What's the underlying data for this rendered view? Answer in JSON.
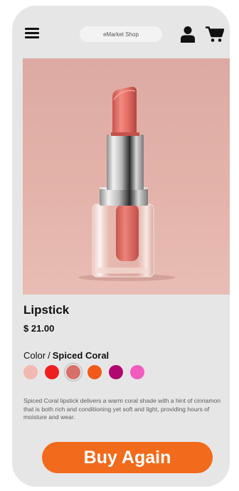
{
  "header": {
    "menu_icon": "hamburger-menu-icon",
    "search_label": "eMarket Shop",
    "user_icon": "user-icon",
    "cart_icon": "shopping-cart-icon"
  },
  "product": {
    "image_icon": "lipstick-product-photo",
    "title": "Lipstick",
    "price": "$ 21.00",
    "color_label": "Color",
    "color_separator": "/",
    "selected_color": "Spiced Coral",
    "swatches": [
      {
        "color": "#f2b8b2",
        "selected": false
      },
      {
        "color": "#ee1f1f",
        "selected": false
      },
      {
        "color": "#d86f6b",
        "selected": true
      },
      {
        "color": "#f25a1a",
        "selected": false
      },
      {
        "color": "#b0086e",
        "selected": false
      },
      {
        "color": "#f35bbf",
        "selected": false
      }
    ],
    "description": "Spiced Coral lipstick delivers a warm coral shade with a hint of cinnamon that is both rich and conditioning yet soft and light, providing hours of moisture and wear."
  },
  "actions": {
    "buy_label": "Buy Again"
  },
  "colors": {
    "accent": "#f26a1b",
    "background": "#e6e6e6"
  }
}
